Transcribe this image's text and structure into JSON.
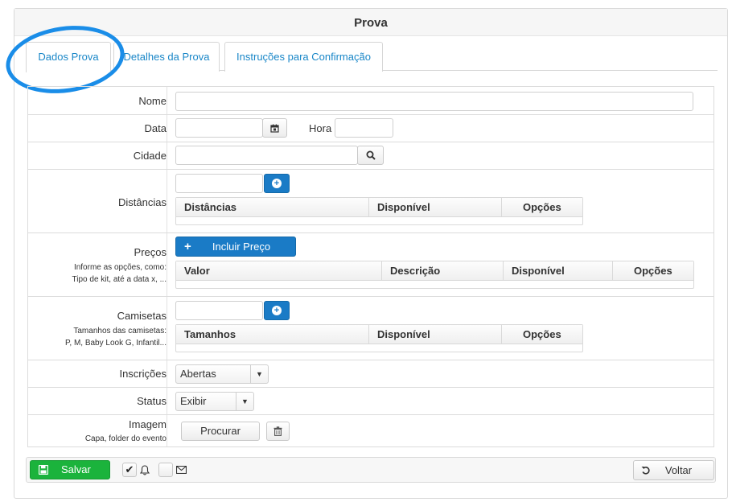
{
  "panel": {
    "title": "Prova"
  },
  "tabs": [
    {
      "label": "Dados Prova",
      "active": true
    },
    {
      "label": "Detalhes da Prova",
      "active": false
    },
    {
      "label": "Instruções para Confirmação",
      "active": false
    }
  ],
  "form": {
    "nome": {
      "label": "Nome",
      "value": ""
    },
    "data": {
      "label": "Data",
      "value": "",
      "hora_label": "Hora",
      "hora_value": ""
    },
    "cidade": {
      "label": "Cidade",
      "value": ""
    },
    "distancias": {
      "label": "Distâncias",
      "input_value": "",
      "columns": [
        "Distâncias",
        "Disponível",
        "Opções"
      ]
    },
    "precos": {
      "label": "Preços",
      "hint_line1": "Informe as opções, como:",
      "hint_line2": "Tipo de kit, até a data x, ...",
      "add_button": "Incluir Preço",
      "columns": [
        "Valor",
        "Descrição",
        "Disponível",
        "Opções"
      ]
    },
    "camisetas": {
      "label": "Camisetas",
      "hint_line1": "Tamanhos das camisetas:",
      "hint_line2": "P, M, Baby Look G, Infantil...",
      "input_value": "",
      "columns": [
        "Tamanhos",
        "Disponível",
        "Opções"
      ]
    },
    "inscricoes": {
      "label": "Inscrições",
      "selected": "Abertas"
    },
    "status": {
      "label": "Status",
      "selected": "Exibir"
    },
    "imagem": {
      "label": "Imagem",
      "hint": "Capa, folder do evento",
      "browse_button": "Procurar"
    }
  },
  "footer": {
    "save_label": "Salvar",
    "back_label": "Voltar",
    "notify_checked": true,
    "email_checked": false
  },
  "colors": {
    "accent_blue": "#1a7bc6",
    "link_blue": "#1a87c8",
    "save_green": "#1bb33c",
    "highlight_circle": "#1a8de8"
  },
  "icons": {
    "calendar": "calendar-icon",
    "search": "search-icon",
    "plus": "plus-circle-icon",
    "trash": "trash-icon",
    "save": "floppy-disk-icon",
    "bell": "bell-icon",
    "envelope": "envelope-icon",
    "back": "undo-icon"
  }
}
